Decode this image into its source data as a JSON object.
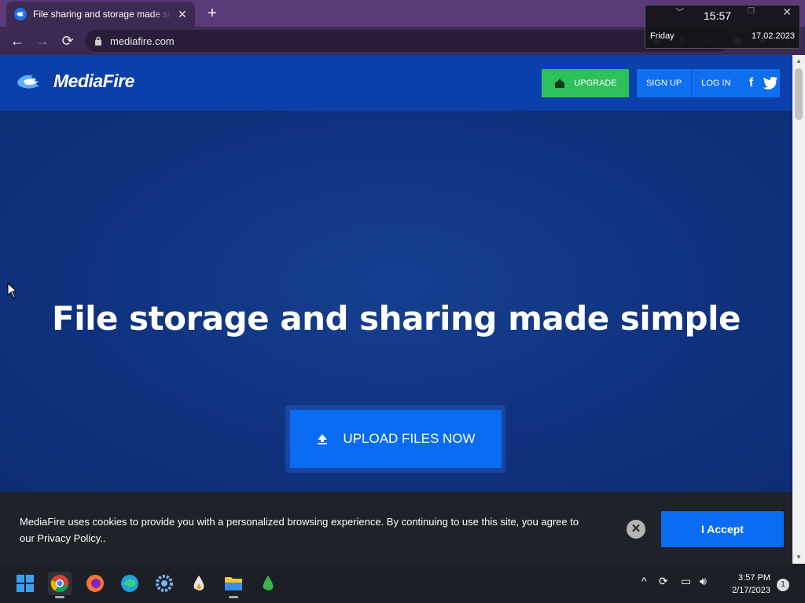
{
  "browser": {
    "tab_title": "File sharing and storage made simple",
    "tab_close": "✕",
    "new_tab": "+",
    "url": "mediafire.com",
    "back": "←",
    "forward": "→",
    "reload": "⟳"
  },
  "clock_overlay": {
    "time": "15:57",
    "day": "Friday",
    "date": "17.02.2023"
  },
  "header": {
    "logo_text": "MediaFire",
    "upgrade_label": "UPGRADE",
    "signup_label": "SIGN UP",
    "login_label": "LOG IN",
    "facebook_glyph": "f",
    "twitter_glyph": "🐦"
  },
  "hero": {
    "title": "File storage and sharing made simple",
    "upload_label": "UPLOAD FILES NOW"
  },
  "cookie_banner": {
    "message": "MediaFire uses cookies to provide you with a personalized browsing experience. By continuing to use this site, you agree to our Privacy Policy..",
    "dismiss": "✕",
    "accept_label": "I Accept"
  },
  "taskbar": {
    "time": "3:57 PM",
    "date": "2/17/2023",
    "notifications": "1",
    "tray_chevron": "^"
  },
  "colors": {
    "brand_blue": "#0a6cf2",
    "header_blue": "#0b3fa9",
    "hero_blue": "#10307f",
    "upgrade_green": "#2ec05a",
    "cookie_bg": "#1f2329"
  }
}
